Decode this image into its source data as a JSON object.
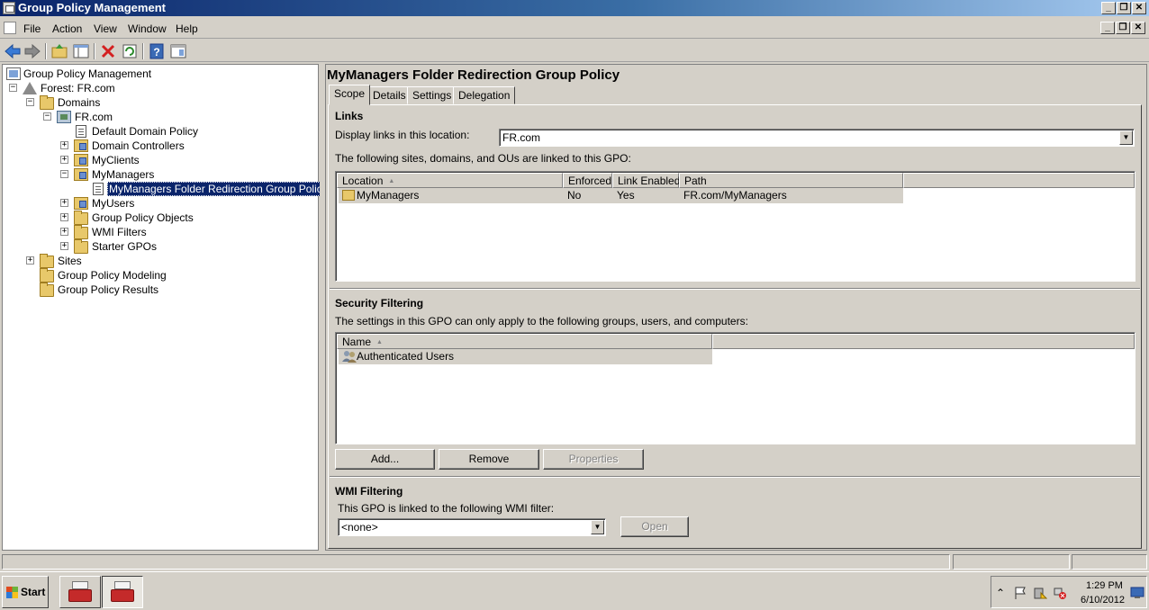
{
  "window": {
    "title": "Group Policy Management",
    "controls": {
      "minimize": "_",
      "maximize": "❐",
      "close": "✕"
    }
  },
  "menu": [
    "File",
    "Action",
    "View",
    "Window",
    "Help"
  ],
  "toolbar": {
    "icons": [
      "back-icon",
      "forward-icon",
      "up-folder-icon",
      "show-hide-tree-icon",
      "delete-icon",
      "refresh-icon",
      "help-icon",
      "properties-icon"
    ]
  },
  "tree": {
    "root": "Group Policy Management",
    "forest": "Forest: FR.com",
    "domains": "Domains",
    "domain": "FR.com",
    "default_policy": "Default Domain Policy",
    "domain_controllers": "Domain Controllers",
    "myclients": "MyClients",
    "mymanagers": "MyManagers",
    "selected_gpo": "MyManagers Folder Redirection Group Policy",
    "myusers": "MyUsers",
    "gpo_objects": "Group Policy Objects",
    "wmi_filters": "WMI Filters",
    "starter_gpos": "Starter GPOs",
    "sites": "Sites",
    "modeling": "Group Policy Modeling",
    "results": "Group Policy Results"
  },
  "detail": {
    "title": "MyManagers Folder Redirection Group Policy",
    "tabs": [
      "Scope",
      "Details",
      "Settings",
      "Delegation"
    ],
    "active_tab": "Scope",
    "links": {
      "heading": "Links",
      "location_label": "Display links in this location:",
      "location_value": "FR.com",
      "info": "The following sites, domains, and OUs are linked to this GPO:",
      "columns": [
        "Location",
        "Enforced",
        "Link Enabled",
        "Path"
      ],
      "rows": [
        {
          "location": "MyManagers",
          "enforced": "No",
          "link_enabled": "Yes",
          "path": "FR.com/MyManagers"
        }
      ]
    },
    "security": {
      "heading": "Security Filtering",
      "info": "The settings in this GPO can only apply to the following groups, users, and computers:",
      "columns": [
        "Name"
      ],
      "rows": [
        "Authenticated Users"
      ],
      "buttons": {
        "add": "Add...",
        "remove": "Remove",
        "properties": "Properties"
      }
    },
    "wmi": {
      "heading": "WMI Filtering",
      "info": "This GPO is linked to the following WMI filter:",
      "value": "<none>",
      "open_button": "Open"
    }
  },
  "taskbar": {
    "start": "Start",
    "clock_time": "1:29 PM",
    "clock_date": "6/10/2012"
  }
}
